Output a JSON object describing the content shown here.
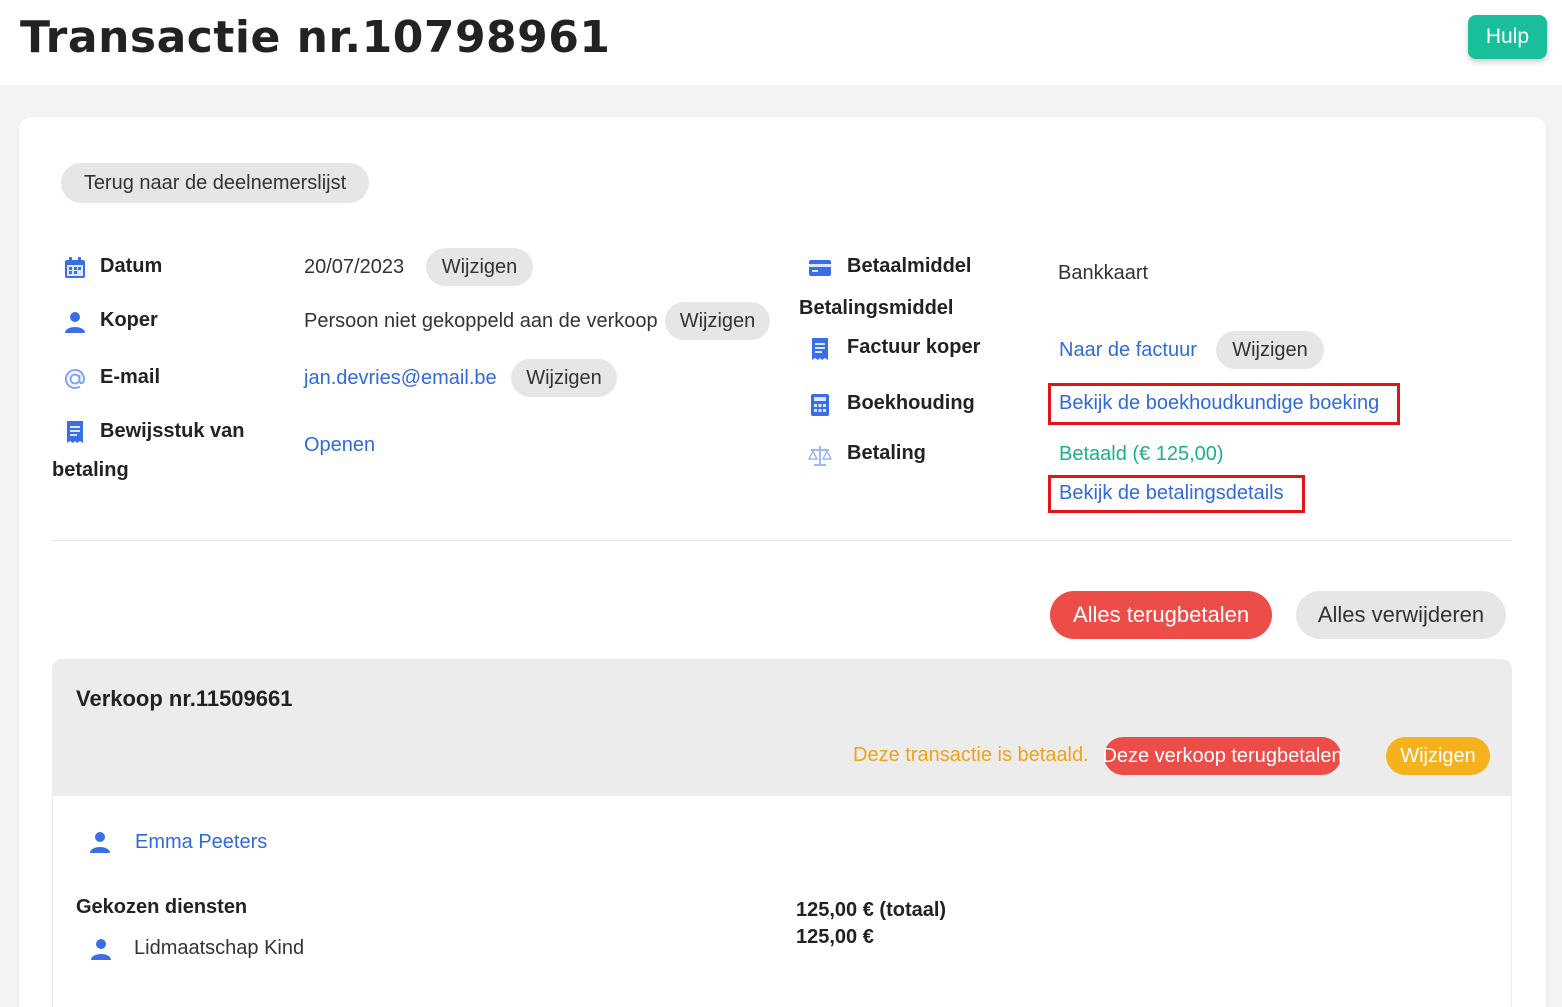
{
  "header": {
    "title": "Transactie nr.10798961",
    "help_label": "Hulp"
  },
  "back_button": "Terug naar de deelnemerslijst",
  "details_left": {
    "date_label": "Datum",
    "date_value": "20/07/2023",
    "buyer_label": "Koper",
    "buyer_value": "Persoon niet gekoppeld aan de verkoop",
    "email_label": "E-mail",
    "email_value": "jan.devries@email.be",
    "proof_label_line1": "Bewijsstuk van",
    "proof_label_line2": "betaling",
    "proof_link": "Openen",
    "edit_label": "Wijzigen"
  },
  "details_right": {
    "payment_method_label": "Betaalmiddel",
    "payment_method_value": "Bankkaart",
    "payment_method_sub": "Betalingsmiddel",
    "invoice_label": "Factuur koper",
    "invoice_link": "Naar de factuur",
    "accounting_label": "Boekhouding",
    "accounting_link": "Bekijk de boekhoudkundige boeking",
    "payment_label": "Betaling",
    "payment_status": "Betaald (€ 125,00)",
    "payment_details_link": "Bekijk de betalingsdetails",
    "edit_label": "Wijzigen"
  },
  "actions": {
    "refund_all": "Alles terugbetalen",
    "delete_all": "Alles verwijderen"
  },
  "sale": {
    "title": "Verkoop nr.11509661",
    "paid_note": "Deze transactie is betaald.",
    "refund_sale": "Deze verkoop terugbetalen",
    "edit": "Wijzigen",
    "participant": "Emma Peeters",
    "services_heading": "Gekozen diensten",
    "service_item": "Lidmaatschap Kind",
    "total": "125,00 € (totaal)",
    "item_price": "125,00 €"
  },
  "colors": {
    "accent_green": "#19bf9a",
    "link_blue": "#2f6bd8",
    "danger_red": "#ec4d48",
    "warning_yellow": "#f5b21c",
    "highlight_red": "#e01616"
  }
}
